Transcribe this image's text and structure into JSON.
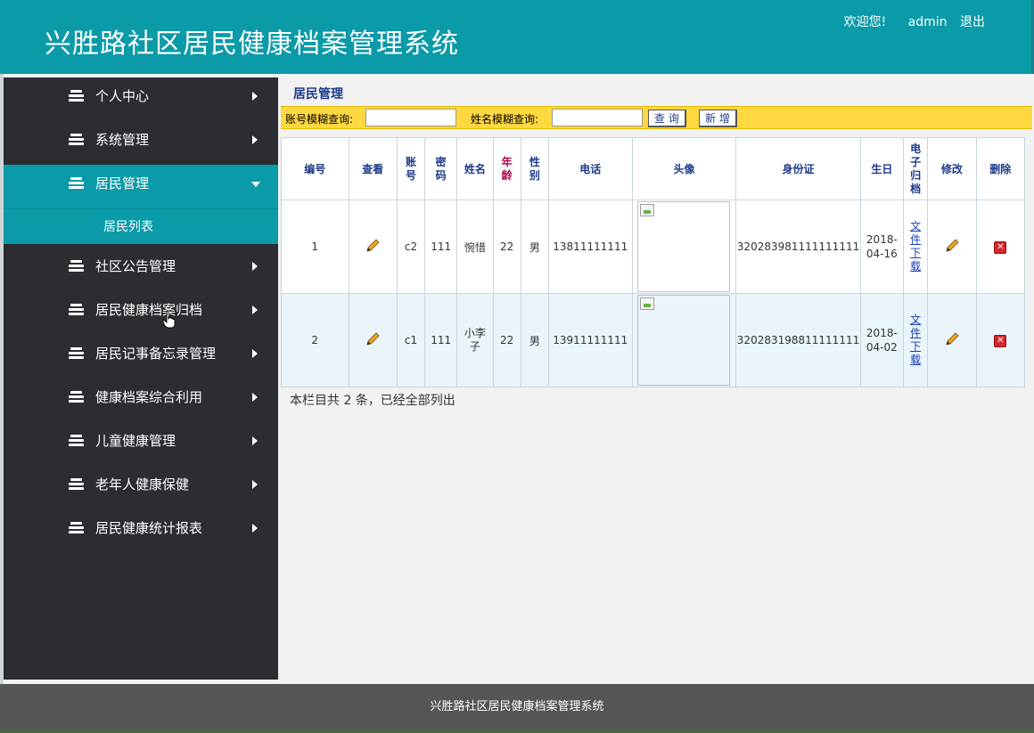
{
  "header": {
    "title": "兴胜路社区居民健康档案管理系统",
    "welcome": "欢迎您!",
    "username": "admin",
    "logout": "退出"
  },
  "sidebar": {
    "items": [
      {
        "label": "个人中心",
        "icon": "list-icon"
      },
      {
        "label": "系统管理",
        "icon": "list-icon"
      },
      {
        "label": "居民管理",
        "icon": "list-icon",
        "active": true,
        "expanded": true
      },
      {
        "label": "社区公告管理",
        "icon": "list-icon"
      },
      {
        "label": "居民健康档案归档",
        "icon": "list-icon"
      },
      {
        "label": "居民记事备忘录管理",
        "icon": "list-icon"
      },
      {
        "label": "健康档案综合利用",
        "icon": "list-icon"
      },
      {
        "label": "儿童健康管理",
        "icon": "list-icon"
      },
      {
        "label": "老年人健康保健",
        "icon": "list-icon"
      },
      {
        "label": "居民健康统计报表",
        "icon": "list-icon"
      }
    ],
    "submenu": {
      "label": "居民列表"
    }
  },
  "main": {
    "section_title": "居民管理",
    "search": {
      "account_label": "账号模糊查询:",
      "account_value": "",
      "name_label": "姓名模糊查询:",
      "name_value": "",
      "query_button": "查 询",
      "add_button": "新 增"
    },
    "table": {
      "headers": [
        "编号",
        "查看",
        "账号",
        "密码",
        "姓名",
        "年龄",
        "性别",
        "电话",
        "头像",
        "身份证",
        "生日",
        "电子归档",
        "修改",
        "删除"
      ],
      "rows": [
        {
          "id": "1",
          "account": "c2",
          "password": "111",
          "name": "惋惜",
          "age": "22",
          "gender": "男",
          "phone": "13811111111",
          "id_card": "320283981111111111",
          "birthday": "2018-04-16",
          "archive": "文件下载"
        },
        {
          "id": "2",
          "account": "c1",
          "password": "111",
          "name": "小李子",
          "age": "22",
          "gender": "男",
          "phone": "13911111111",
          "id_card": "320283198811111111",
          "birthday": "2018-04-02",
          "archive": "文件下载"
        }
      ]
    },
    "summary": "本栏目共 2 条，已经全部列出"
  },
  "footer": {
    "text": "兴胜路社区居民健康档案管理系统"
  },
  "colors": {
    "header": "#0b9aa8",
    "sidebar": "#2b2d33",
    "searchbar": "#ffd73f",
    "footer": "#555555"
  }
}
